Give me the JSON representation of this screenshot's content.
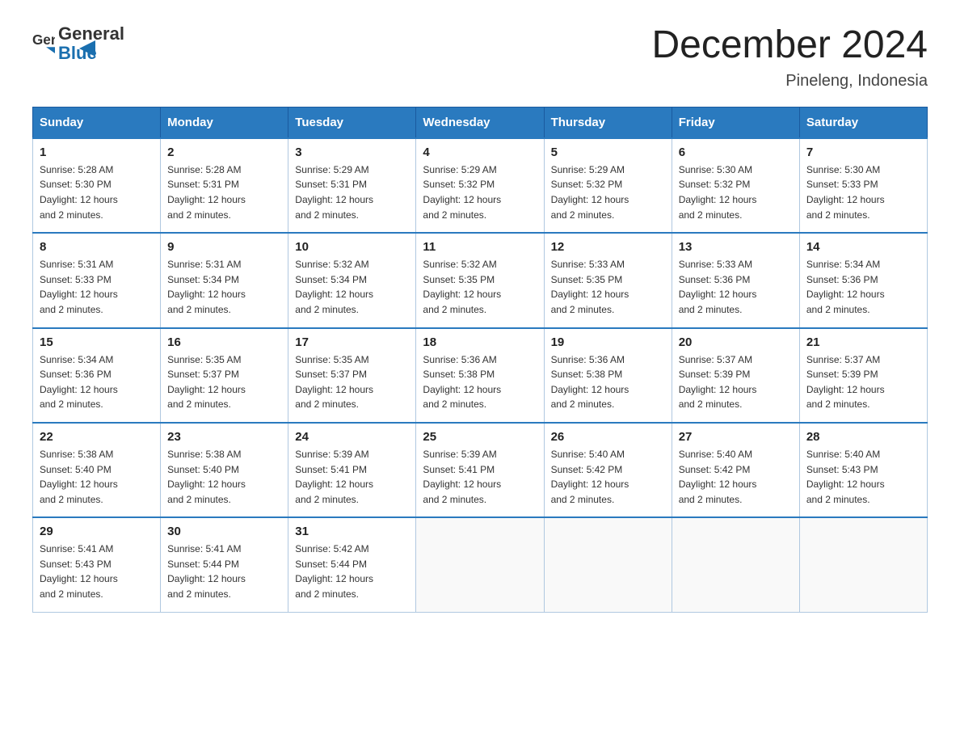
{
  "logo": {
    "text_general": "General",
    "text_blue": "Blue"
  },
  "title": "December 2024",
  "subtitle": "Pineleng, Indonesia",
  "days_of_week": [
    "Sunday",
    "Monday",
    "Tuesday",
    "Wednesday",
    "Thursday",
    "Friday",
    "Saturday"
  ],
  "weeks": [
    [
      {
        "day": "1",
        "sunrise": "5:28 AM",
        "sunset": "5:30 PM",
        "daylight": "12 hours and 2 minutes."
      },
      {
        "day": "2",
        "sunrise": "5:28 AM",
        "sunset": "5:31 PM",
        "daylight": "12 hours and 2 minutes."
      },
      {
        "day": "3",
        "sunrise": "5:29 AM",
        "sunset": "5:31 PM",
        "daylight": "12 hours and 2 minutes."
      },
      {
        "day": "4",
        "sunrise": "5:29 AM",
        "sunset": "5:32 PM",
        "daylight": "12 hours and 2 minutes."
      },
      {
        "day": "5",
        "sunrise": "5:29 AM",
        "sunset": "5:32 PM",
        "daylight": "12 hours and 2 minutes."
      },
      {
        "day": "6",
        "sunrise": "5:30 AM",
        "sunset": "5:32 PM",
        "daylight": "12 hours and 2 minutes."
      },
      {
        "day": "7",
        "sunrise": "5:30 AM",
        "sunset": "5:33 PM",
        "daylight": "12 hours and 2 minutes."
      }
    ],
    [
      {
        "day": "8",
        "sunrise": "5:31 AM",
        "sunset": "5:33 PM",
        "daylight": "12 hours and 2 minutes."
      },
      {
        "day": "9",
        "sunrise": "5:31 AM",
        "sunset": "5:34 PM",
        "daylight": "12 hours and 2 minutes."
      },
      {
        "day": "10",
        "sunrise": "5:32 AM",
        "sunset": "5:34 PM",
        "daylight": "12 hours and 2 minutes."
      },
      {
        "day": "11",
        "sunrise": "5:32 AM",
        "sunset": "5:35 PM",
        "daylight": "12 hours and 2 minutes."
      },
      {
        "day": "12",
        "sunrise": "5:33 AM",
        "sunset": "5:35 PM",
        "daylight": "12 hours and 2 minutes."
      },
      {
        "day": "13",
        "sunrise": "5:33 AM",
        "sunset": "5:36 PM",
        "daylight": "12 hours and 2 minutes."
      },
      {
        "day": "14",
        "sunrise": "5:34 AM",
        "sunset": "5:36 PM",
        "daylight": "12 hours and 2 minutes."
      }
    ],
    [
      {
        "day": "15",
        "sunrise": "5:34 AM",
        "sunset": "5:36 PM",
        "daylight": "12 hours and 2 minutes."
      },
      {
        "day": "16",
        "sunrise": "5:35 AM",
        "sunset": "5:37 PM",
        "daylight": "12 hours and 2 minutes."
      },
      {
        "day": "17",
        "sunrise": "5:35 AM",
        "sunset": "5:37 PM",
        "daylight": "12 hours and 2 minutes."
      },
      {
        "day": "18",
        "sunrise": "5:36 AM",
        "sunset": "5:38 PM",
        "daylight": "12 hours and 2 minutes."
      },
      {
        "day": "19",
        "sunrise": "5:36 AM",
        "sunset": "5:38 PM",
        "daylight": "12 hours and 2 minutes."
      },
      {
        "day": "20",
        "sunrise": "5:37 AM",
        "sunset": "5:39 PM",
        "daylight": "12 hours and 2 minutes."
      },
      {
        "day": "21",
        "sunrise": "5:37 AM",
        "sunset": "5:39 PM",
        "daylight": "12 hours and 2 minutes."
      }
    ],
    [
      {
        "day": "22",
        "sunrise": "5:38 AM",
        "sunset": "5:40 PM",
        "daylight": "12 hours and 2 minutes."
      },
      {
        "day": "23",
        "sunrise": "5:38 AM",
        "sunset": "5:40 PM",
        "daylight": "12 hours and 2 minutes."
      },
      {
        "day": "24",
        "sunrise": "5:39 AM",
        "sunset": "5:41 PM",
        "daylight": "12 hours and 2 minutes."
      },
      {
        "day": "25",
        "sunrise": "5:39 AM",
        "sunset": "5:41 PM",
        "daylight": "12 hours and 2 minutes."
      },
      {
        "day": "26",
        "sunrise": "5:40 AM",
        "sunset": "5:42 PM",
        "daylight": "12 hours and 2 minutes."
      },
      {
        "day": "27",
        "sunrise": "5:40 AM",
        "sunset": "5:42 PM",
        "daylight": "12 hours and 2 minutes."
      },
      {
        "day": "28",
        "sunrise": "5:40 AM",
        "sunset": "5:43 PM",
        "daylight": "12 hours and 2 minutes."
      }
    ],
    [
      {
        "day": "29",
        "sunrise": "5:41 AM",
        "sunset": "5:43 PM",
        "daylight": "12 hours and 2 minutes."
      },
      {
        "day": "30",
        "sunrise": "5:41 AM",
        "sunset": "5:44 PM",
        "daylight": "12 hours and 2 minutes."
      },
      {
        "day": "31",
        "sunrise": "5:42 AM",
        "sunset": "5:44 PM",
        "daylight": "12 hours and 2 minutes."
      },
      null,
      null,
      null,
      null
    ]
  ],
  "labels": {
    "sunrise": "Sunrise:",
    "sunset": "Sunset:",
    "daylight": "Daylight: 12 hours"
  }
}
